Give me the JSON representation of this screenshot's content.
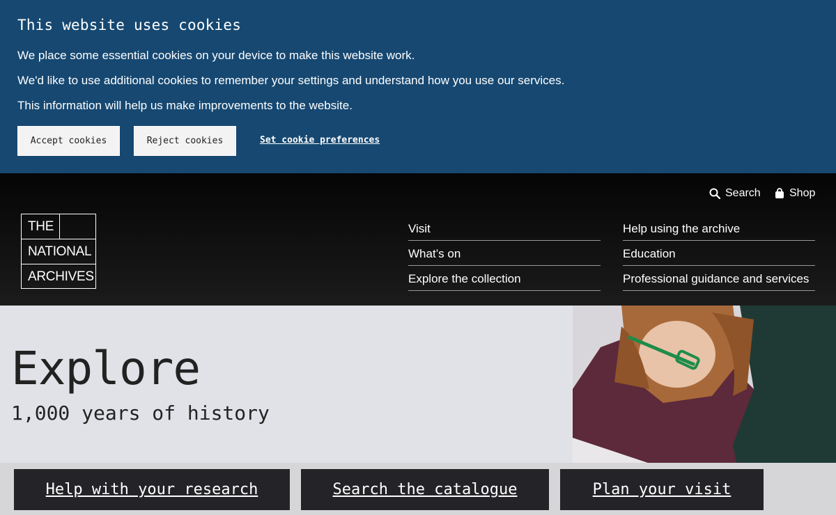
{
  "cookie_banner": {
    "title": "This website uses cookies",
    "paragraphs": [
      "We place some essential cookies on your device to make this website work.",
      "We'd like to use additional cookies to remember your settings and understand how you use our services.",
      "This information will help us make improvements to the website."
    ],
    "accept_label": "Accept cookies",
    "reject_label": "Reject cookies",
    "preferences_label": "Set cookie preferences",
    "background_color": "#164871"
  },
  "header": {
    "utility": {
      "search_label": "Search",
      "shop_label": "Shop"
    },
    "logo": {
      "line1": "THE",
      "line2": "NATIONAL",
      "line3": "ARCHIVES"
    },
    "nav_col1": [
      "Visit",
      "What’s on",
      "Explore the collection"
    ],
    "nav_col2": [
      "Help using the archive",
      "Education",
      "Professional guidance and services"
    ]
  },
  "hero": {
    "title": "Explore",
    "subtitle": "1,000 years of history",
    "cta": [
      "Help with your research",
      "Search the catalogue",
      "Plan your visit"
    ]
  }
}
